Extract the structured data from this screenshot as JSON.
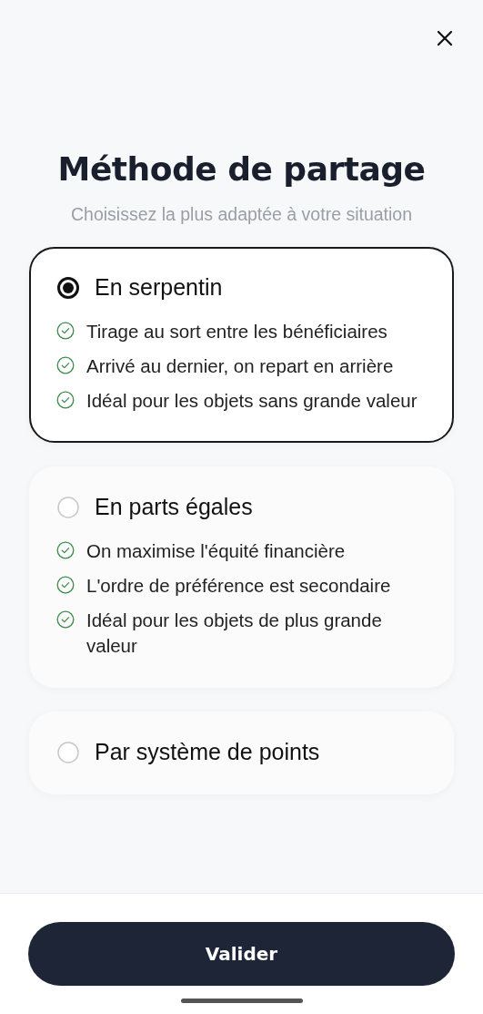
{
  "title": "Méthode de partage",
  "subtitle": "Choisissez la plus adaptée à votre situation",
  "options": [
    {
      "label": "En serpentin",
      "selected": true,
      "features": [
        "Tirage au sort entre les bénéficiaires",
        "Arrivé au dernier, on repart en arrière",
        "Idéal pour les objets sans grande valeur"
      ]
    },
    {
      "label": "En parts égales",
      "selected": false,
      "features": [
        "On maximise l'équité financière",
        "L'ordre de préférence est secondaire",
        "Idéal pour les objets de plus grande valeur"
      ]
    },
    {
      "label": "Par système de points",
      "selected": false
    }
  ],
  "submit": "Valider"
}
